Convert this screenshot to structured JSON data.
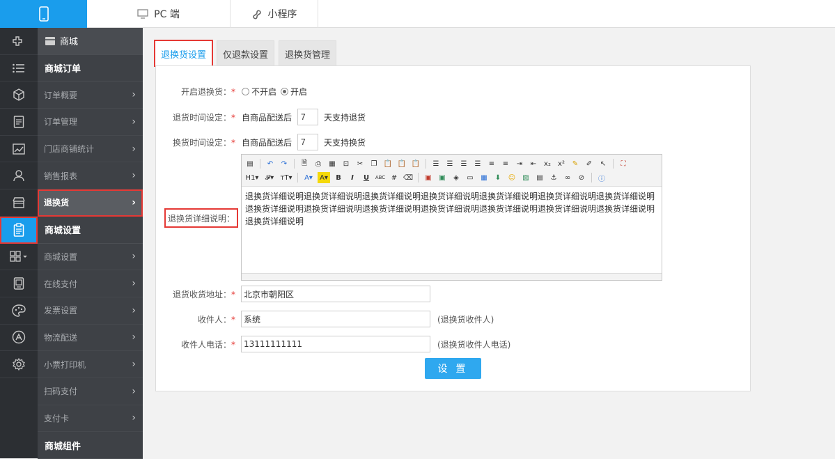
{
  "topbar": {
    "tabs": [
      {
        "label": "PC 端",
        "icon": "monitor-icon"
      },
      {
        "label": "小程序",
        "icon": "miniprogram-icon"
      }
    ],
    "active_icon": "mobile-icon"
  },
  "iconbar": {
    "items": [
      "plugin-icon",
      "list-icon",
      "cube-icon",
      "document-icon",
      "chart-icon",
      "user-icon",
      "store-icon",
      "clipboard-icon",
      "grid-icon",
      "tablet-icon",
      "palette-icon",
      "appstore-icon",
      "settings-icon"
    ]
  },
  "menu": {
    "store_title": "商城",
    "group_orders": "商城订单",
    "items_a": [
      "订单概要",
      "订单管理",
      "门店商铺统计",
      "销售报表"
    ],
    "active_item": "退换货",
    "group_settings": "商城设置",
    "items_b": [
      "商城设置",
      "在线支付",
      "发票设置",
      "物流配送",
      "小票打印机",
      "扫码支付",
      "支付卡"
    ],
    "group_components": "商城组件"
  },
  "tabs": [
    "退换货设置",
    "仅退款设置",
    "退换货管理"
  ],
  "form": {
    "enable": {
      "label": "开启退换货：",
      "opt_off": "不开启",
      "opt_on": "开启",
      "selected": "开启"
    },
    "return_time": {
      "label": "退货时间设定：",
      "prefix": "自商品配送后",
      "value": "7",
      "suffix": "天支持退货"
    },
    "exchange_time": {
      "label": "换货时间设定：",
      "prefix": "自商品配送后",
      "value": "7",
      "suffix": "天支持换货"
    },
    "desc_label": "退换货详细说明：",
    "desc_text": "退换货详细说明退换货详细说明退换货详细说明退换货详细说明退换货详细说明退换货详细说明退换货详细说明退换货详细说明退换货详细说明退换货详细说明退换货详细说明退换货详细说明退换货详细说明退换货详细说明退换货详细说明",
    "address": {
      "label": "退货收货地址：",
      "value": "北京市朝阳区"
    },
    "receiver": {
      "label": "收件人：",
      "value": "系统",
      "hint": "(退换货收件人)"
    },
    "phone": {
      "label": "收件人电话：",
      "value": "13111111111",
      "hint": "(退换货收件人电话)"
    },
    "submit": "设 置"
  },
  "colors": {
    "accent": "#1a9dec",
    "highlight": "#e53935",
    "sidebar": "#2c2f33"
  }
}
